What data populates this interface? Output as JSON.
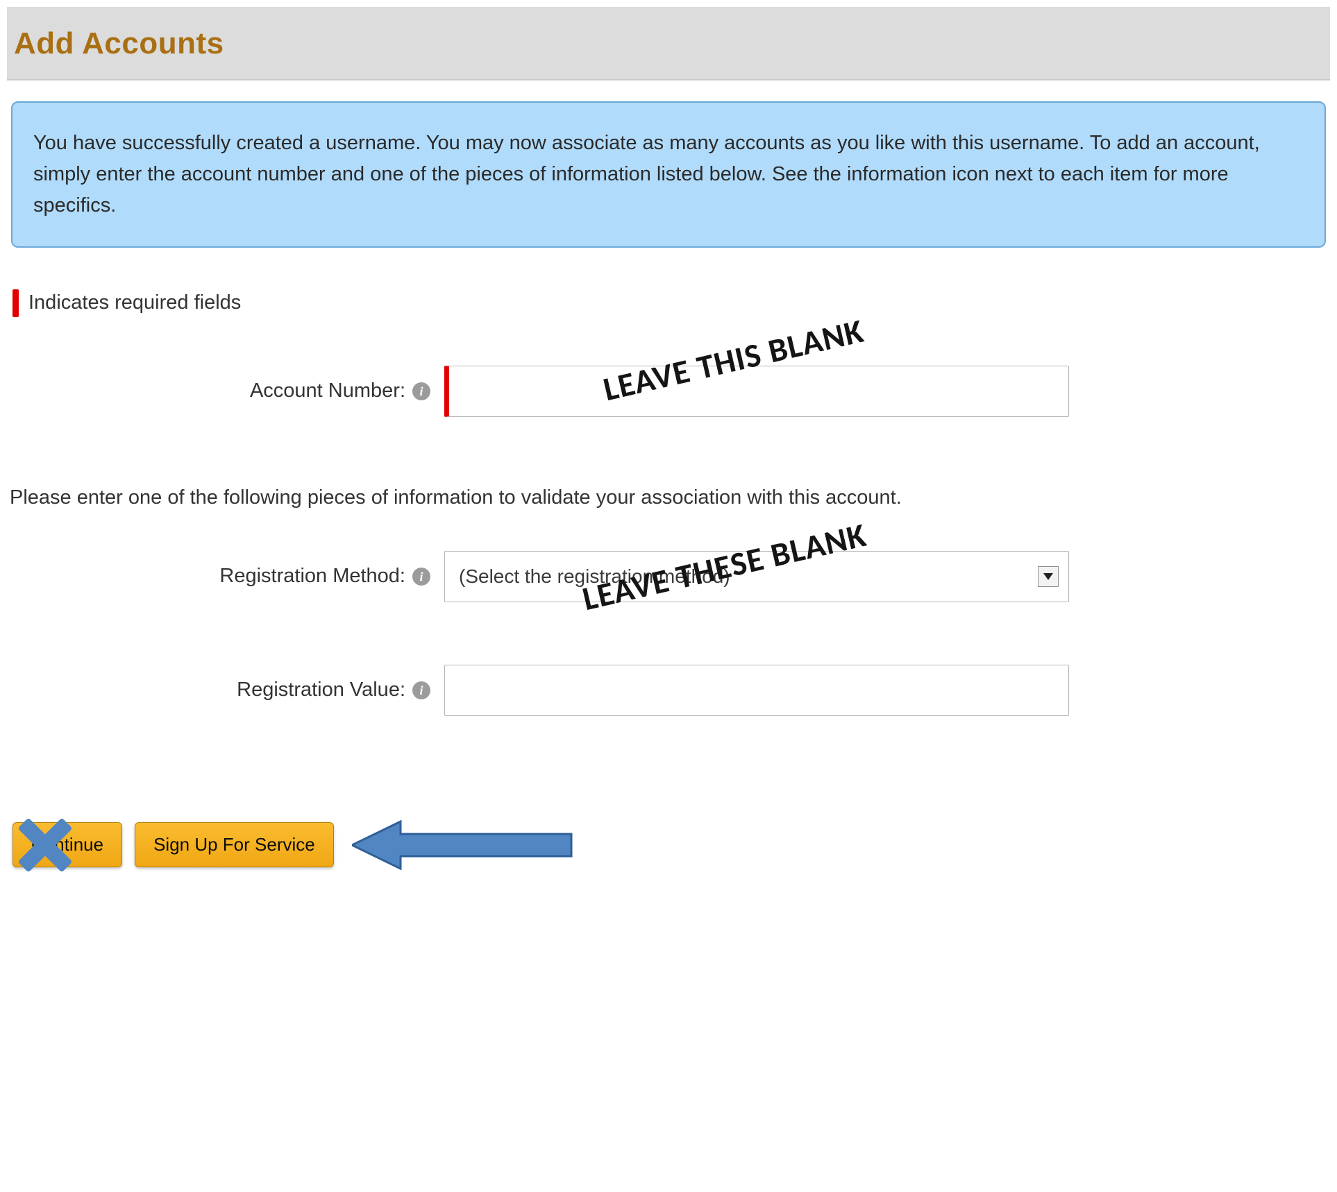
{
  "header": {
    "title": "Add Accounts"
  },
  "info_box": {
    "text": "You have successfully created a username. You may now associate as many accounts as you like with this username. To add an account, simply enter the account number and one of the pieces of information listed below. See the information icon next to each item for more specifics."
  },
  "required_note": "Indicates required fields",
  "fields": {
    "account_number": {
      "label": "Account Number:",
      "value": ""
    },
    "instruction": "Please enter one of the following pieces of information to validate your association with this account.",
    "registration_method": {
      "label": "Registration Method:",
      "selected": "(Select the registration method)"
    },
    "registration_value": {
      "label": "Registration Value:",
      "value": ""
    }
  },
  "annotations": {
    "blank_single": "LEAVE THIS BLANK",
    "blank_plural": "LEAVE THESE BLANK"
  },
  "actions": {
    "continue": "Continue",
    "signup": "Sign Up For Service"
  },
  "icons": {
    "info_glyph": "i"
  },
  "colors": {
    "accent_brown": "#a96f12",
    "info_bg": "#b1dbfa",
    "info_border": "#6aa9d9",
    "required_red": "#e20000",
    "button_top": "#fabc2f",
    "button_bottom": "#f0a715",
    "arrow_blue": "#5186c3"
  }
}
